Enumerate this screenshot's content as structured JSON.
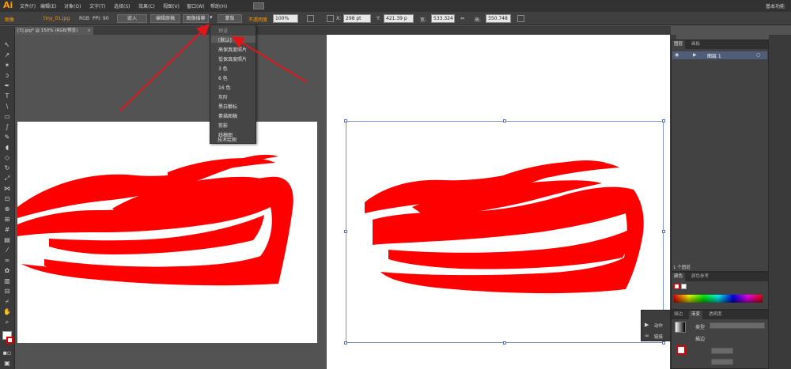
{
  "app": {
    "logo": "Ai"
  },
  "menubar": {
    "items": [
      "文件(F)",
      "编辑(E)",
      "对象(O)",
      "文字(T)",
      "选择(S)",
      "效果(C)",
      "视图(V)",
      "窗口(W)",
      "帮助(H)"
    ],
    "workspace": "基本功能"
  },
  "controlbar": {
    "selection_label": "图像",
    "filename": "tiny_01.jpg",
    "color_mode": "RGB",
    "ppi": "PPI: 90",
    "embed": "嵌入",
    "edit_original": "编辑原稿",
    "trace_preset": "图像描摹",
    "mask": "蒙版",
    "opacity_label": "不透明度",
    "opacity_value": "100%",
    "x_value": "298 pt",
    "y_value": "421.39 p",
    "w_value": "533.324",
    "h_value": "350.748"
  },
  "document": {
    "tab_title": "[3].jpg* @ 150% (RGB/预览)"
  },
  "dropdown": {
    "header": "预设",
    "items": [
      "[默认]",
      "高保真度照片",
      "低保真度照片",
      "3 色",
      "6 色",
      "16 色",
      "灰阶",
      "黑白徽标",
      "素描图稿",
      "剪影",
      "线稿图",
      "技术绘图"
    ]
  },
  "layers_panel": {
    "tabs": [
      "图层",
      "画板"
    ],
    "layer_name": "图层 1",
    "status": "1 个图层"
  },
  "color_panel": {
    "tabs": [
      "颜色",
      "颜色参考"
    ]
  },
  "actions_panel": {
    "items": [
      "动作",
      "链接"
    ]
  },
  "gradient_panel": {
    "tabs": [
      "描边",
      "渐变",
      "透明度"
    ],
    "type_label": "类型",
    "stroke_label": "描边"
  },
  "colors": {
    "accent": "#ff9a00",
    "artwork": "#ff0000",
    "selection": "#7b8fe0"
  },
  "annotation_arrows": 2
}
